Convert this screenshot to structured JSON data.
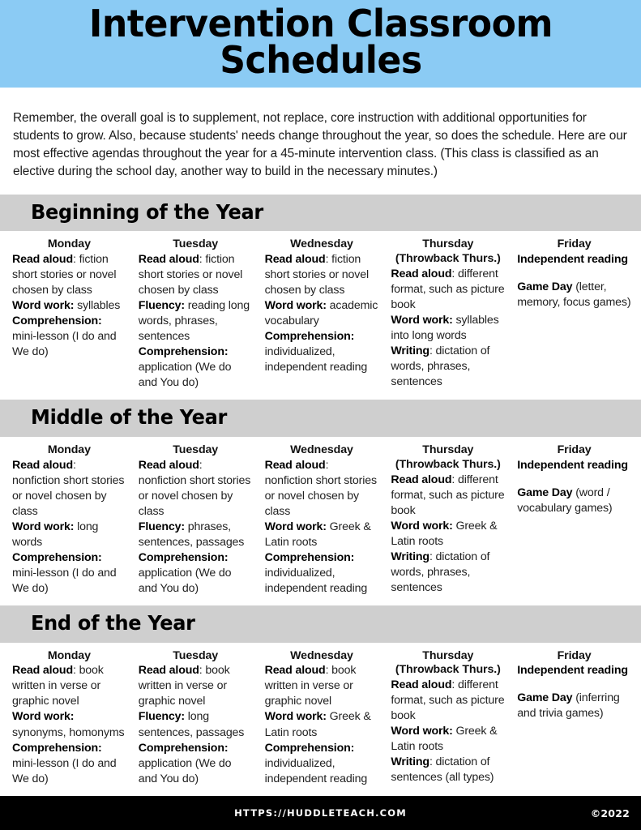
{
  "page": {
    "title": "Intervention Classroom Schedules",
    "title_line1": "Intervention Classroom",
    "title_line2": "Schedules",
    "header_bg": "#8BCBF4",
    "section_header_bg": "#CFCFCF",
    "footer_bg": "#000000",
    "intro": "Remember, the overall goal is to supplement, not replace, core instruction with additional opportunities for students to grow. Also, because students' needs change throughout the year, so does the schedule. Here are our most effective agendas throughout the year for a 45-minute intervention class. (This class is classified as an elective during the school day, another way to build in the necessary minutes.)"
  },
  "footer": {
    "url": "HTTPS://HUDDLETEACH.COM",
    "copyright": "©2022"
  },
  "sections": [
    {
      "title": "Beginning of the Year",
      "days": [
        {
          "name": "Monday",
          "name_sub": "",
          "items": [
            {
              "label": "Read aloud",
              "sep": ": ",
              "text": "fiction short stories or novel chosen by class"
            },
            {
              "label": "Word work:",
              "sep": " ",
              "text": "syllables"
            },
            {
              "label": "Comprehension:",
              "sep": " ",
              "text": "mini-lesson (I do and We do)"
            }
          ]
        },
        {
          "name": "Tuesday",
          "name_sub": "",
          "items": [
            {
              "label": "Read aloud",
              "sep": ": ",
              "text": "fiction short stories or novel chosen by class"
            },
            {
              "label": "Fluency:",
              "sep": " ",
              "text": "reading long words, phrases, sentences"
            },
            {
              "label": "Comprehension:",
              "sep": " ",
              "text": "application (We do and You do)"
            }
          ]
        },
        {
          "name": "Wednesday",
          "name_sub": "",
          "items": [
            {
              "label": "Read aloud",
              "sep": ": ",
              "text": "fiction short stories or novel chosen by class"
            },
            {
              "label": "Word work:",
              "sep": " ",
              "text": "academic vocabulary"
            },
            {
              "label": "Comprehension:",
              "sep": " ",
              "text": "individualized, independent reading"
            }
          ]
        },
        {
          "name": "Thursday",
          "name_sub": "(Throwback Thurs.)",
          "items": [
            {
              "label": "Read aloud",
              "sep": ": ",
              "text": "different format, such as picture book"
            },
            {
              "label": "Word work:",
              "sep": " ",
              "text": "syllables into long words"
            },
            {
              "label": "Writing",
              "sep": ": ",
              "text": "dictation of words, phrases, sentences"
            }
          ]
        },
        {
          "name": "Friday",
          "name_sub": "",
          "items": [
            {
              "label": "Independent reading",
              "sep": "",
              "text": ""
            },
            {
              "label": "Game Day",
              "sep": " ",
              "text": "(letter, memory, focus games)",
              "spaced": true
            }
          ]
        }
      ]
    },
    {
      "title": "Middle of the Year",
      "days": [
        {
          "name": "Monday",
          "name_sub": "",
          "items": [
            {
              "label": "Read aloud",
              "sep": ": ",
              "text": "nonfiction short stories or novel chosen by class"
            },
            {
              "label": "Word work:",
              "sep": " ",
              "text": "long words"
            },
            {
              "label": "Comprehension:",
              "sep": " ",
              "text": "mini-lesson (I do and We do)"
            }
          ]
        },
        {
          "name": "Tuesday",
          "name_sub": "",
          "items": [
            {
              "label": "Read aloud",
              "sep": ": ",
              "text": "nonfiction  short stories or novel chosen by class"
            },
            {
              "label": "Fluency:",
              "sep": " ",
              "text": "phrases, sentences, passages"
            },
            {
              "label": "Comprehension:",
              "sep": " ",
              "text": "application (We do and You do)"
            }
          ]
        },
        {
          "name": "Wednesday",
          "name_sub": "",
          "items": [
            {
              "label": "Read aloud",
              "sep": ": ",
              "text": "nonfiction short stories or novel chosen by class"
            },
            {
              "label": "Word work:",
              "sep": " ",
              "text": "Greek & Latin roots"
            },
            {
              "label": "Comprehension:",
              "sep": " ",
              "text": "individualized, independent reading"
            }
          ]
        },
        {
          "name": "Thursday",
          "name_sub": "(Throwback Thurs.)",
          "items": [
            {
              "label": "Read aloud",
              "sep": ": ",
              "text": "different format, such as picture book"
            },
            {
              "label": "Word work:",
              "sep": " ",
              "text": "Greek & Latin roots"
            },
            {
              "label": "Writing",
              "sep": ": ",
              "text": "dictation of words, phrases, sentences"
            }
          ]
        },
        {
          "name": "Friday",
          "name_sub": "",
          "items": [
            {
              "label": "Independent reading",
              "sep": "",
              "text": ""
            },
            {
              "label": "Game Day",
              "sep": " ",
              "text": "(word / vocabulary games)",
              "spaced": true
            }
          ]
        }
      ]
    },
    {
      "title": "End of the Year",
      "days": [
        {
          "name": "Monday",
          "name_sub": "",
          "items": [
            {
              "label": "Read aloud",
              "sep": ": ",
              "text": "book written in verse or graphic novel"
            },
            {
              "label": "Word work:",
              "sep": " ",
              "text": "synonyms, homonyms"
            },
            {
              "label": "Comprehension:",
              "sep": " ",
              "text": "mini-lesson (I do and We do)"
            }
          ]
        },
        {
          "name": "Tuesday",
          "name_sub": "",
          "items": [
            {
              "label": "Read aloud",
              "sep": ": ",
              "text": "book written in verse or graphic novel"
            },
            {
              "label": "Fluency:",
              "sep": " ",
              "text": "long sentences, passages"
            },
            {
              "label": "Comprehension:",
              "sep": " ",
              "text": "application (We do and You do)"
            }
          ]
        },
        {
          "name": "Wednesday",
          "name_sub": "",
          "items": [
            {
              "label": "Read aloud",
              "sep": ": ",
              "text": "book written in verse or graphic novel"
            },
            {
              "label": "Word work:",
              "sep": " ",
              "text": "Greek & Latin roots"
            },
            {
              "label": "Comprehension:",
              "sep": " ",
              "text": "individualized, independent reading"
            }
          ]
        },
        {
          "name": "Thursday",
          "name_sub": "(Throwback Thurs.)",
          "items": [
            {
              "label": "Read aloud",
              "sep": ": ",
              "text": "different format, such as picture book"
            },
            {
              "label": "Word work:",
              "sep": " ",
              "text": "Greek & Latin roots"
            },
            {
              "label": "Writing",
              "sep": ": ",
              "text": "dictation of sentences (all types)"
            }
          ]
        },
        {
          "name": "Friday",
          "name_sub": "",
          "items": [
            {
              "label": "Independent reading",
              "sep": "",
              "text": ""
            },
            {
              "label": "Game Day",
              "sep": " ",
              "text": "(inferring and trivia games)",
              "spaced": true
            }
          ]
        }
      ]
    }
  ]
}
